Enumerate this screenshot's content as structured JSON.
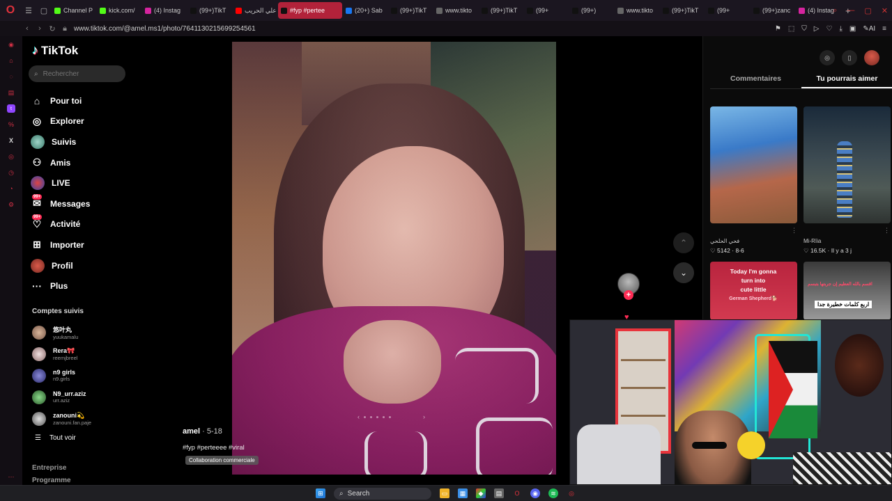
{
  "browser": {
    "tabs": [
      {
        "label": "Channel P",
        "favicon": "kick-icon",
        "color": "#53fc18"
      },
      {
        "label": "kick.com/",
        "favicon": "kick-icon",
        "color": "#53fc18"
      },
      {
        "label": "(4) Instag",
        "favicon": "instagram-icon",
        "color": "#d6249f"
      },
      {
        "label": "(99+)TikT",
        "favicon": "tiktok-icon",
        "color": "#111111"
      },
      {
        "label": "علي الحريب",
        "favicon": "youtube-icon",
        "color": "#ff0000"
      },
      {
        "label": "#fyp #pertee",
        "favicon": "tiktok-icon",
        "color": "#111111",
        "active": true
      },
      {
        "label": "(20+) Sab",
        "favicon": "facebook-icon",
        "color": "#1877f2"
      },
      {
        "label": "(99+)TikT",
        "favicon": "tiktok-icon",
        "color": "#111111"
      },
      {
        "label": "www.tikto",
        "favicon": "page-icon",
        "color": "#666666"
      },
      {
        "label": "(99+)TikT",
        "favicon": "tiktok-icon",
        "color": "#111111"
      },
      {
        "label": "(99+",
        "favicon": "tiktok-icon",
        "color": "#111111"
      },
      {
        "label": "(99+)",
        "favicon": "tiktok-icon",
        "color": "#111111"
      },
      {
        "label": "www.tikto",
        "favicon": "page-icon",
        "color": "#666666"
      },
      {
        "label": "(99+)TikT",
        "favicon": "tiktok-icon",
        "color": "#111111"
      },
      {
        "label": "(99+",
        "favicon": "tiktok-icon",
        "color": "#111111"
      },
      {
        "label": "(99+)zanc",
        "favicon": "tiktok-icon",
        "color": "#111111"
      },
      {
        "label": "(4) Instag",
        "favicon": "instagram-icon",
        "color": "#d6249f"
      }
    ],
    "url": "www.tiktok.com/@amel.ms1/photo/7641130215699254561"
  },
  "tiktok": {
    "logo": "TikTok",
    "search_placeholder": "Rechercher",
    "nav": [
      {
        "label": "Pour toi",
        "icon": "home-icon"
      },
      {
        "label": "Explorer",
        "icon": "compass-icon"
      },
      {
        "label": "Suivis",
        "icon": "following-avatar-icon"
      },
      {
        "label": "Amis",
        "icon": "friends-icon"
      },
      {
        "label": "LIVE",
        "icon": "live-icon"
      },
      {
        "label": "Messages",
        "icon": "messages-icon",
        "badge": "99+"
      },
      {
        "label": "Activité",
        "icon": "activity-icon",
        "badge": "99+"
      },
      {
        "label": "Importer",
        "icon": "upload-icon"
      },
      {
        "label": "Profil",
        "icon": "profile-avatar-icon"
      },
      {
        "label": "Plus",
        "icon": "more-icon"
      }
    ],
    "following_title": "Comptes suivis",
    "following": [
      {
        "name": "悠叶丸",
        "handle": "yuukamalu"
      },
      {
        "name": "Rera🎀",
        "handle": "reemjbreel"
      },
      {
        "name": "n9 girls",
        "handle": "n9.girls"
      },
      {
        "name": "N9_urr.aziz",
        "handle": "urr.aziz"
      },
      {
        "name": "zanouni💫",
        "handle": "zanouni.fan.paje"
      }
    ],
    "see_all": "Tout voir",
    "footer_1": "Entreprise",
    "footer_2": "Programme",
    "post": {
      "author": "amel",
      "date": "· 5-18",
      "tags": "#fyp #perteeee #viral",
      "collab": "Collaboration commerciale"
    },
    "right_tabs": [
      "Commentaires",
      "Tu pourrais aimer"
    ],
    "suggestions": [
      {
        "author": "فحي الحلحي",
        "stats": "♡ 5142 · 8-6"
      },
      {
        "author": "Mi-Rīia",
        "stats": "♡ 16.5K · Il y a 3 j"
      }
    ],
    "thumb3_lines": [
      "Today I'm gonna",
      "turn into",
      "cute little",
      "German Shepherd🐕"
    ],
    "thumb4_red": "اقسم بالله العظيم إن جربتها بتبسم",
    "thumb4_caption": "اربع كلمات خطيرة جدا"
  },
  "taskbar": {
    "search_label": "Search"
  }
}
